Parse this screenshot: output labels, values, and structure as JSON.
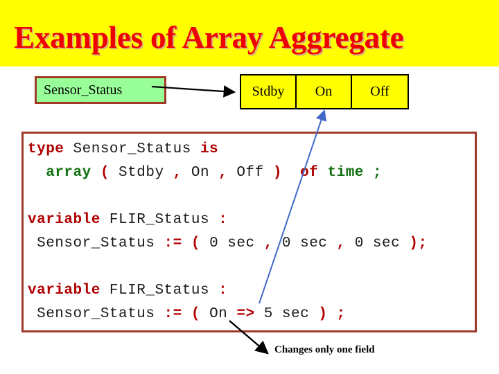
{
  "slide": {
    "title": "Examples of Array Aggregate",
    "banner_color": "#ffff00",
    "title_color": "#ee0000"
  },
  "sensor_box": {
    "label": "Sensor_Status",
    "fill_color": "#99ff99",
    "border_color": "#a03a28"
  },
  "array_table": {
    "fill_color": "#ffff00",
    "border_color": "#000000",
    "cells": [
      {
        "label": "Stdby"
      },
      {
        "label": "On"
      },
      {
        "label": "Off"
      }
    ]
  },
  "code_box": {
    "border_color": "#a03a28",
    "lines": [
      {
        "id": "line-type-decl",
        "tokens": [
          {
            "text": "type",
            "style": "kw-red"
          },
          {
            "text": " Sensor_Status ",
            "style": "tok-plain"
          },
          {
            "text": "is",
            "style": "kw-red"
          }
        ]
      },
      {
        "id": "line-array-decl",
        "tokens": [
          {
            "text": "  ",
            "style": "tok-plain"
          },
          {
            "text": "array",
            "style": "kw-green"
          },
          {
            "text": " ",
            "style": "tok-plain"
          },
          {
            "text": "(",
            "style": "tok-red"
          },
          {
            "text": " Stdby ",
            "style": "tok-plain"
          },
          {
            "text": ",",
            "style": "tok-red"
          },
          {
            "text": " On ",
            "style": "tok-plain"
          },
          {
            "text": ",",
            "style": "tok-red"
          },
          {
            "text": " Off ",
            "style": "tok-plain"
          },
          {
            "text": ")",
            "style": "tok-red"
          },
          {
            "text": "  ",
            "style": "tok-plain"
          },
          {
            "text": "of",
            "style": "kw-red"
          },
          {
            "text": " ",
            "style": "tok-plain"
          },
          {
            "text": "time",
            "style": "kw-green"
          },
          {
            "text": " ",
            "style": "tok-plain"
          },
          {
            "text": ";",
            "style": "kw-green"
          }
        ]
      },
      {
        "id": "line-blank-1",
        "blank": true,
        "tokens": []
      },
      {
        "id": "line-var-decl-1",
        "tokens": [
          {
            "text": "variable",
            "style": "kw-red"
          },
          {
            "text": " FLIR_Status ",
            "style": "tok-plain"
          },
          {
            "text": ":",
            "style": "tok-red"
          }
        ]
      },
      {
        "id": "line-assign-full",
        "tokens": [
          {
            "text": " Sensor_Status ",
            "style": "tok-plain"
          },
          {
            "text": ":=",
            "style": "tok-red"
          },
          {
            "text": " ",
            "style": "tok-plain"
          },
          {
            "text": "(",
            "style": "tok-red"
          },
          {
            "text": " 0 sec ",
            "style": "tok-plain"
          },
          {
            "text": ",",
            "style": "tok-red"
          },
          {
            "text": " 0 sec ",
            "style": "tok-plain"
          },
          {
            "text": ",",
            "style": "tok-red"
          },
          {
            "text": " 0 sec ",
            "style": "tok-plain"
          },
          {
            "text": ");",
            "style": "tok-red"
          }
        ]
      },
      {
        "id": "line-blank-2",
        "blank": true,
        "tokens": []
      },
      {
        "id": "line-var-decl-2",
        "tokens": [
          {
            "text": "variable",
            "style": "kw-red"
          },
          {
            "text": " FLIR_Status ",
            "style": "tok-plain"
          },
          {
            "text": ":",
            "style": "tok-red"
          }
        ]
      },
      {
        "id": "line-assign-named",
        "tokens": [
          {
            "text": " Sensor_Status ",
            "style": "tok-plain"
          },
          {
            "text": ":=",
            "style": "tok-red"
          },
          {
            "text": " ",
            "style": "tok-plain"
          },
          {
            "text": "(",
            "style": "tok-red"
          },
          {
            "text": " On ",
            "style": "tok-plain"
          },
          {
            "text": "=>",
            "style": "tok-red"
          },
          {
            "text": " 5 sec ",
            "style": "tok-plain"
          },
          {
            "text": ")",
            "style": "tok-red"
          },
          {
            "text": " ",
            "style": "tok-plain"
          },
          {
            "text": ";",
            "style": "tok-red"
          }
        ]
      }
    ]
  },
  "annotations": {
    "caption": "Changes only one field",
    "blue_arrow_color": "#4169c8",
    "black_arrow_color": "#000000"
  }
}
